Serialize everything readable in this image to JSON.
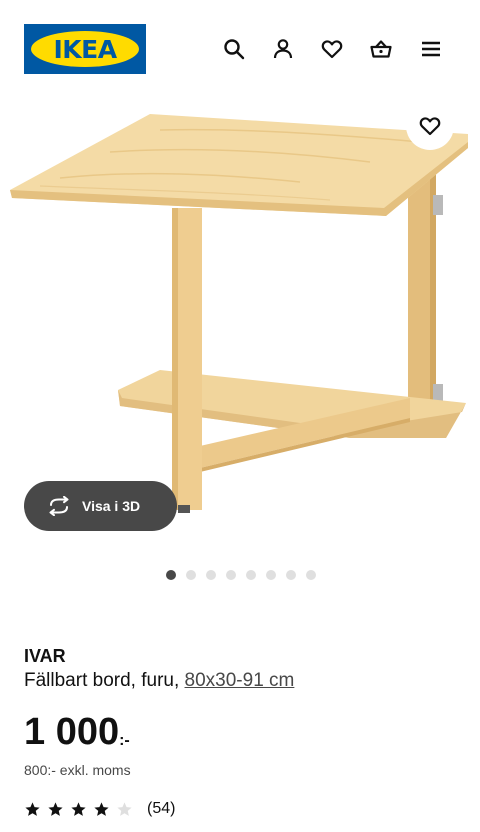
{
  "header": {
    "logo_text": "IKEA",
    "icons": [
      "search-icon",
      "user-icon",
      "heart-icon",
      "basket-icon",
      "menu-icon"
    ]
  },
  "gallery": {
    "view_3d_label": "Visa i 3D",
    "total_images": 8,
    "active_index": 0
  },
  "product": {
    "name": "IVAR",
    "type_text": "Fällbart bord, furu,",
    "measurement": "80x30-91 cm",
    "price": "1 000",
    "price_suffix": ":-",
    "price_excl_vat": "800:- exkl. moms",
    "rating_value": 4,
    "rating_max": 5,
    "review_count": "(54)"
  },
  "colors": {
    "ikea_blue": "#0058a3",
    "ikea_yellow": "#ffdb00",
    "wood_light": "#f3d9a2",
    "wood_mid": "#e8c47f"
  }
}
